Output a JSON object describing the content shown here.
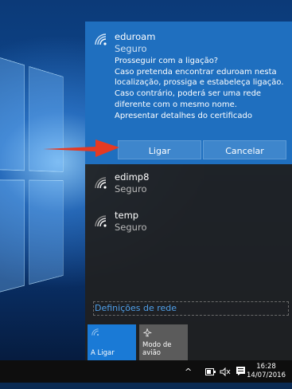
{
  "networks": [
    {
      "name": "eduroam",
      "status": "Seguro"
    },
    {
      "name": "edimp8",
      "status": "Seguro"
    },
    {
      "name": "temp",
      "status": "Seguro"
    }
  ],
  "prompt": {
    "question": "Prosseguir com a ligação?",
    "message": "Caso pretenda encontrar eduroam nesta localização, prossiga e estabeleça ligação. Caso contrário, poderá ser uma rede diferente com o mesmo nome.",
    "cert_link": "Apresentar detalhes do certificado",
    "connect_label": "Ligar",
    "cancel_label": "Cancelar"
  },
  "settings_link": "Definições de rede",
  "quick_actions": [
    {
      "label": "A Ligar",
      "icon": "wifi-icon"
    },
    {
      "label": "Modo de avião",
      "icon": "airplane-icon"
    }
  ],
  "taskbar": {
    "time": "16:28",
    "date": "14/07/2016"
  },
  "colors": {
    "accent": "#1f6fbf",
    "button": "#3e86cc",
    "link": "#4f9fe8",
    "arrow": "#e53a23"
  }
}
